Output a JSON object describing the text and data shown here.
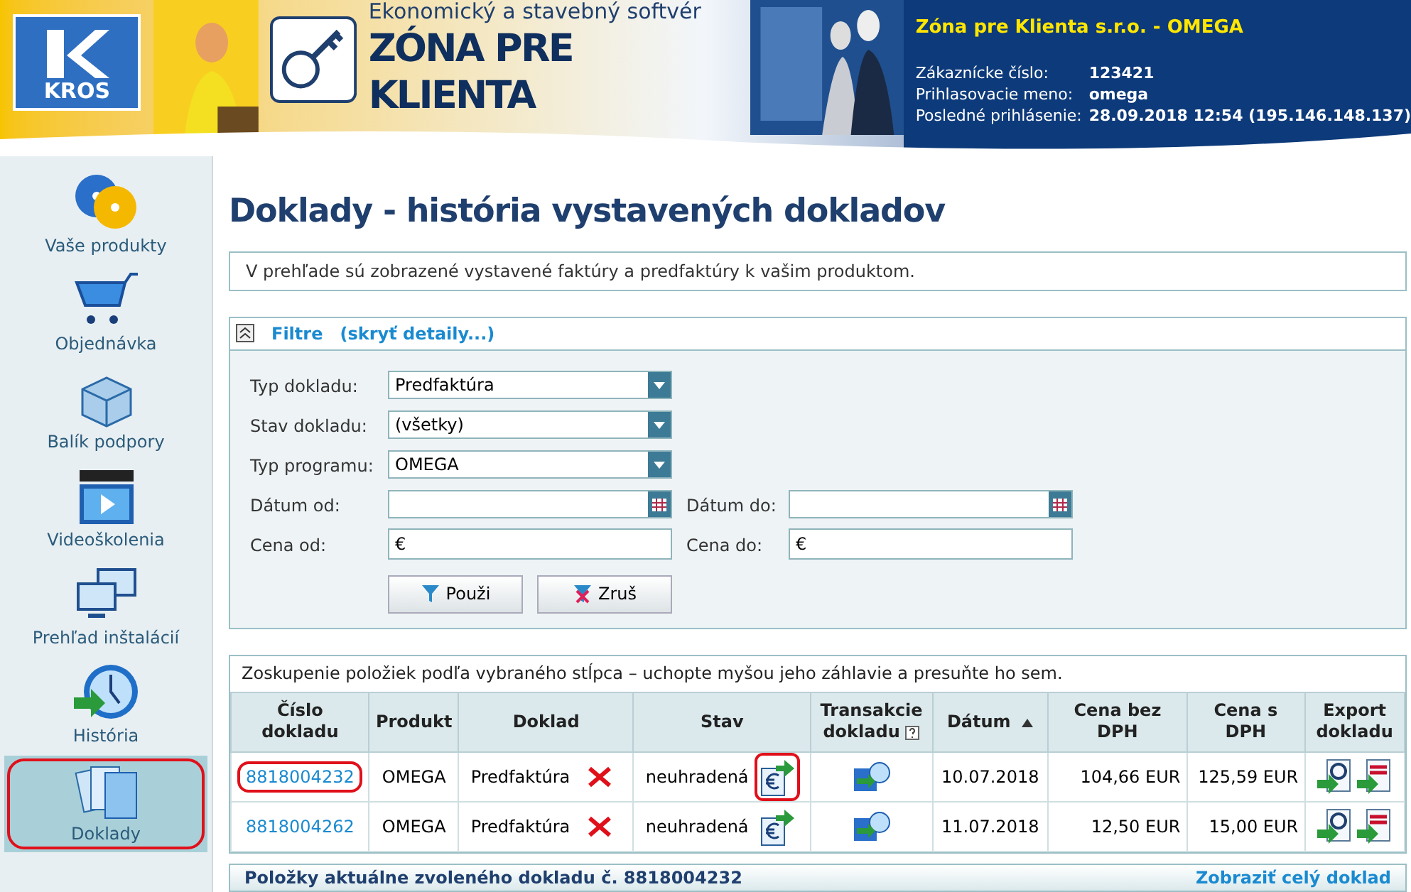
{
  "header": {
    "logo_text": "KROS",
    "tagline": "Ekonomický a stavebný softvér",
    "product": "ZÓNA PRE KLIENTA",
    "company": "Zóna pre Klienta s.r.o. - OMEGA",
    "info": [
      {
        "label": "Zákaznícke číslo:",
        "value": "123421"
      },
      {
        "label": "Prihlasovacie meno:",
        "value": "omega"
      },
      {
        "label": "Posledné prihlásenie:",
        "value": "28.09.2018 12:54 (195.146.148.137)"
      }
    ]
  },
  "sidebar": {
    "items": [
      {
        "label": "Vaše produkty",
        "kind": "discs",
        "selected": false,
        "circled": false
      },
      {
        "label": "Objednávka",
        "kind": "cart",
        "selected": false,
        "circled": false
      },
      {
        "label": "Balík podpory",
        "kind": "box",
        "selected": false,
        "circled": false
      },
      {
        "label": "Videoškolenia",
        "kind": "video",
        "selected": false,
        "circled": false
      },
      {
        "label": "Prehľad inštalácií",
        "kind": "monitors",
        "selected": false,
        "circled": false
      },
      {
        "label": "História",
        "kind": "clock",
        "selected": false,
        "circled": false
      },
      {
        "label": "Doklady",
        "kind": "docs",
        "selected": true,
        "circled": true
      }
    ]
  },
  "page_title": "Doklady - história vystavených dokladov",
  "info_text": "V prehľade sú zobrazené vystavené faktúry a predfaktúry k vašim produktom.",
  "filter": {
    "title": "Filtre",
    "toggle": "(skryť detaily...)",
    "expanded": true,
    "fields": [
      {
        "kind": "select",
        "label": "Typ dokladu:",
        "value": "Predfaktúra"
      },
      {
        "kind": "select",
        "label": "Stav dokladu:",
        "value": "(všetky)"
      },
      {
        "kind": "select",
        "label": "Typ programu:",
        "value": "OMEGA"
      },
      {
        "kind": "date_pair",
        "label": "Dátum od:",
        "label2": "Dátum do:"
      },
      {
        "kind": "price_pair",
        "label": "Cena od:",
        "value": "€",
        "label2": "Cena do:",
        "value2": "€"
      }
    ],
    "buttons": [
      {
        "label": "Použi",
        "kind": "apply"
      },
      {
        "label": "Zruš",
        "kind": "clear"
      }
    ]
  },
  "grid": {
    "group_hint": "Zoskupenie položiek podľa vybraného stĺpca – uchopte myšou jeho záhlavie a presuňte ho sem.",
    "columns": [
      {
        "label": "Číslo dokladu",
        "help": false,
        "sorted": false
      },
      {
        "label": "Produkt",
        "help": false,
        "sorted": false
      },
      {
        "label": "Doklad",
        "help": false,
        "sorted": false
      },
      {
        "label": "Stav",
        "help": false,
        "sorted": false
      },
      {
        "label": "Transakcie dokladu",
        "help": true,
        "sorted": false
      },
      {
        "label": "Dátum",
        "help": false,
        "sorted": true
      },
      {
        "label": "Cena bez DPH",
        "help": false,
        "sorted": false
      },
      {
        "label": "Cena s DPH",
        "help": false,
        "sorted": false
      },
      {
        "label": "Export dokladu",
        "help": false,
        "sorted": false
      }
    ],
    "rows": [
      {
        "number": "8818004232",
        "number_circled": true,
        "product": "OMEGA",
        "doc": "Predfaktúra",
        "status": "neuhradená",
        "pay_circled": true,
        "date": "10.07.2018",
        "net": "104,66 EUR",
        "gross": "125,59 EUR"
      },
      {
        "number": "8818004262",
        "number_circled": false,
        "product": "OMEGA",
        "doc": "Predfaktúra",
        "status": "neuhradená",
        "pay_circled": false,
        "date": "11.07.2018",
        "net": "12,50 EUR",
        "gross": "15,00 EUR"
      }
    ]
  },
  "detail_bar": {
    "title": "Položky aktuálne zvoleného dokladu č. 8818004232",
    "link": "Zobraziť celý doklad"
  }
}
